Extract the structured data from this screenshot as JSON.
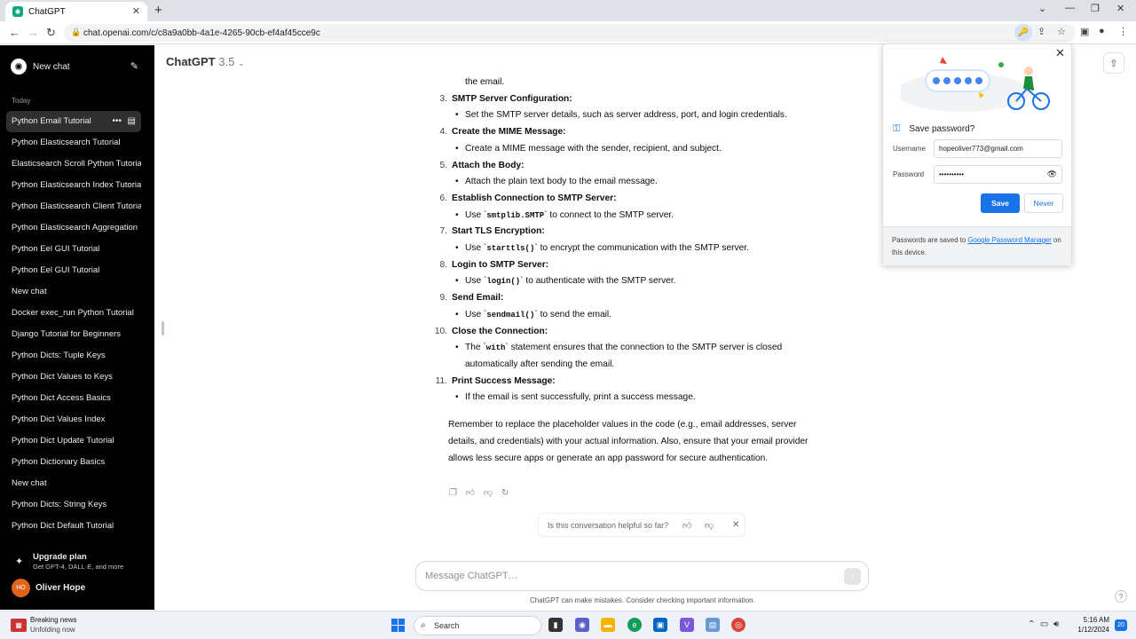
{
  "browser": {
    "tab_title": "ChatGPT",
    "url": "chat.openai.com/c/c8a9a0bb-4a1e-4265-90cb-ef4af45cce9c"
  },
  "sidebar": {
    "new_chat": "New chat",
    "section": "Today",
    "chats": [
      "Python Email Tutorial",
      "Python Elasticsearch Tutorial",
      "Elasticsearch Scroll Python Tutorial",
      "Python Elasticsearch Index Tutorial",
      "Python Elasticsearch Client Tutorial",
      "Python Elasticsearch Aggregation",
      "Python Eel GUI Tutorial",
      "Python Eel GUI Tutorial",
      "New chat",
      "Docker exec_run Python Tutorial",
      "Django Tutorial for Beginners",
      "Python Dicts: Tuple Keys",
      "Python Dict Values to Keys",
      "Python Dict Access Basics",
      "Python Dict Values Index",
      "Python Dict Update Tutorial",
      "Python Dictionary Basics",
      "New chat",
      "Python Dicts: String Keys",
      "Python Dict Default Tutorial"
    ],
    "upgrade_title": "Upgrade plan",
    "upgrade_sub": "Get GPT-4, DALL·E, and more",
    "user_initials": "HO",
    "user_name": "Oliver Hope"
  },
  "header": {
    "model": "ChatGPT",
    "version": "3.5"
  },
  "message": {
    "cont_text": "the email.",
    "steps": [
      {
        "num": "3.",
        "title": "SMTP Server Configuration:",
        "parts": [
          "Set the SMTP server details, such as server address, port, and login credentials.",
          "",
          ""
        ]
      },
      {
        "num": "4.",
        "title": "Create the MIME Message:",
        "parts": [
          "Create a MIME message with the sender, recipient, and subject.",
          "",
          ""
        ]
      },
      {
        "num": "5.",
        "title": "Attach the Body:",
        "parts": [
          "Attach the plain text body to the email message.",
          "",
          ""
        ]
      },
      {
        "num": "6.",
        "title": "Establish Connection to SMTP Server:",
        "parts": [
          "Use `",
          "smtplib.SMTP",
          "` to connect to the SMTP server."
        ]
      },
      {
        "num": "7.",
        "title": "Start TLS Encryption:",
        "parts": [
          "Use `",
          "starttls()",
          "` to encrypt the communication with the SMTP server."
        ]
      },
      {
        "num": "8.",
        "title": "Login to SMTP Server:",
        "parts": [
          "Use `",
          "login()",
          "` to authenticate with the SMTP server."
        ]
      },
      {
        "num": "9.",
        "title": "Send Email:",
        "parts": [
          "Use `",
          "sendmail()",
          "` to send the email."
        ]
      },
      {
        "num": "10.",
        "title": "Close the Connection:",
        "parts": [
          "The `",
          "with",
          "` statement ensures that the connection to the SMTP server is closed automatically after sending the email."
        ]
      },
      {
        "num": "11.",
        "title": "Print Success Message:",
        "parts": [
          "If the email is sent successfully, print a success message.",
          "",
          ""
        ]
      }
    ],
    "summary": "Remember to replace the placeholder values in the code (e.g., email addresses, server details, and credentials) with your actual information. Also, ensure that your email provider allows less secure apps or generate an app password for secure authentication."
  },
  "feedback": {
    "question": "Is this conversation helpful so far?"
  },
  "composer": {
    "placeholder": "Message ChatGPT…"
  },
  "disclaimer": "ChatGPT can make mistakes. Consider checking important information.",
  "password_popup": {
    "title": "Save password?",
    "username_label": "Username",
    "username_value": "hopeoliver773@gmail.com",
    "password_label": "Password",
    "password_value": "••••••••••",
    "save": "Save",
    "never": "Never",
    "footer_pre": "Passwords are saved to ",
    "footer_link": "Google Password Manager",
    "footer_post": " on this device."
  },
  "taskbar": {
    "news_title": "Breaking news",
    "news_sub": "Unfolding now",
    "search": "Search",
    "time": "5:16 AM",
    "date": "1/12/2024",
    "notifications": "20"
  },
  "colors": {
    "accent": "#1a73e8",
    "sidebar_bg": "#000000",
    "avatar": "#e2641c"
  }
}
